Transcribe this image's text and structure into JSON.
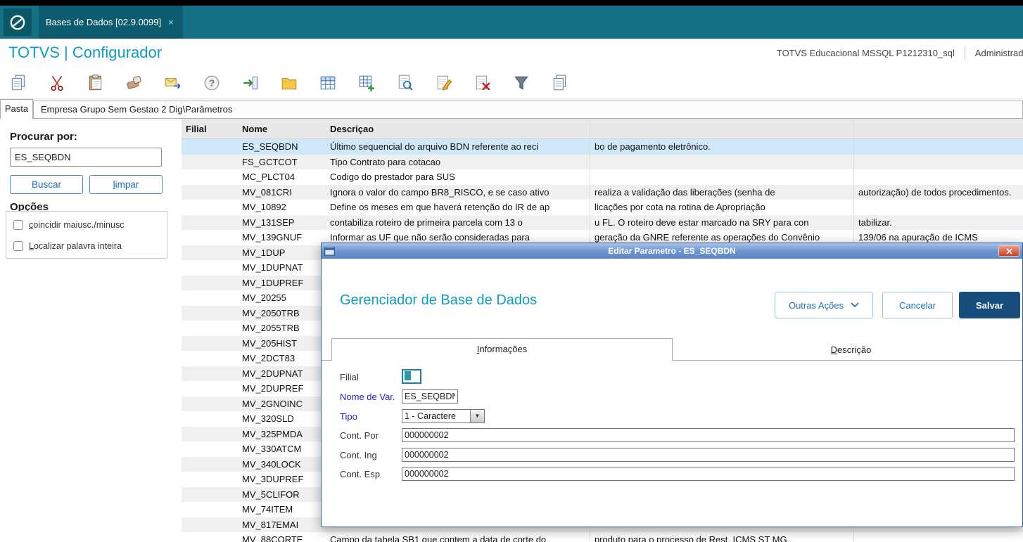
{
  "chrome": {
    "tab": {
      "title": "Bases de Dados [02.9.0099]",
      "close": "×"
    },
    "app_title": "TOTVS | Configurador",
    "environment": "TOTVS Educacional MSSQL P1212310_sql",
    "user": "Administrador"
  },
  "toolbar": {
    "icons": [
      "copy-icon",
      "cut-icon",
      "paste-icon",
      "eraser-icon",
      "send-mail-icon",
      "help-icon",
      "exit-icon",
      "folder-icon",
      "table-icon",
      "table-add-icon",
      "search-doc-icon",
      "edit-icon",
      "delete-doc-icon",
      "filter-icon",
      "copy-pages-icon"
    ]
  },
  "pasta": {
    "tab_label": "Pasta",
    "path": "Empresa Grupo Sem Gestao 2 Dig\\Parâmetros"
  },
  "search": {
    "label": "Procurar por:",
    "value": "ES_SEQBDN",
    "buscar_label": "Buscar",
    "limpar_label": "limpar",
    "options_title": "Opções",
    "options": [
      {
        "label": "coincidir maiusc./minusc",
        "checked": false
      },
      {
        "label": "Localizar palavra inteira",
        "checked": false
      }
    ]
  },
  "table": {
    "columns": [
      "Filial",
      "Nome",
      "Descriçao"
    ],
    "rows": [
      {
        "filial": "",
        "nome": "ES_SEQBDN",
        "desc1": "Último sequencial do arquivo BDN referente ao reci",
        "desc2": "bo de pagamento eletrônico.",
        "desc3": "",
        "selected": true
      },
      {
        "filial": "",
        "nome": "FS_GCTCOT",
        "desc1": "Tipo Contrato para cotacao",
        "desc2": "",
        "desc3": ""
      },
      {
        "filial": "",
        "nome": "MC_PLCT04",
        "desc1": "Codigo do prestador para SUS",
        "desc2": "",
        "desc3": ""
      },
      {
        "filial": "",
        "nome": "MV_081CRI",
        "desc1": "Ignora o valor do campo BR8_RISCO, e se caso ativo",
        "desc2": "realiza a validação das liberações (senha de",
        "desc3": "autorização) de todos procedimentos."
      },
      {
        "filial": "",
        "nome": "MV_10892",
        "desc1": "Define os meses em que haverá retenção do IR de ap",
        "desc2": "licações por cota na rotina de Apropriação",
        "desc3": ""
      },
      {
        "filial": "",
        "nome": "MV_131SEP",
        "desc1": "contabiliza roteiro de primeira parcela com 13 o",
        "desc2": "u FL. O roteiro deve estar marcado na SRY para con",
        "desc3": "tabilizar."
      },
      {
        "filial": "",
        "nome": "MV_139GNUF",
        "desc1": "Informar as UF que não serão consideradas para",
        "desc2": "geração da GNRE referente as operações do Convênio",
        "desc3": "139/06 na apuração de ICMS"
      },
      {
        "filial": "",
        "nome": "MV_1DUP",
        "desc1": "",
        "desc2": "",
        "desc3": ""
      },
      {
        "filial": "",
        "nome": "MV_1DUPNAT",
        "desc1": "",
        "desc2": "",
        "desc3": ""
      },
      {
        "filial": "",
        "nome": "MV_1DUPREF",
        "desc1": "",
        "desc2": "",
        "desc3": ""
      },
      {
        "filial": "",
        "nome": "MV_20255",
        "desc1": "",
        "desc2": "",
        "desc3": ""
      },
      {
        "filial": "",
        "nome": "MV_2050TRB",
        "desc1": "",
        "desc2": "",
        "desc3": ""
      },
      {
        "filial": "",
        "nome": "MV_2055TRB",
        "desc1": "",
        "desc2": "",
        "desc3": ""
      },
      {
        "filial": "",
        "nome": "MV_205HIST",
        "desc1": "",
        "desc2": "",
        "desc3": ""
      },
      {
        "filial": "",
        "nome": "MV_2DCT83",
        "desc1": "",
        "desc2": "",
        "desc3": ""
      },
      {
        "filial": "",
        "nome": "MV_2DUPNAT",
        "desc1": "",
        "desc2": "",
        "desc3": ""
      },
      {
        "filial": "",
        "nome": "MV_2DUPREF",
        "desc1": "",
        "desc2": "",
        "desc3": ""
      },
      {
        "filial": "",
        "nome": "MV_2GNOINC",
        "desc1": "",
        "desc2": "",
        "desc3": ""
      },
      {
        "filial": "",
        "nome": "MV_320SLD",
        "desc1": "",
        "desc2": "",
        "desc3": ""
      },
      {
        "filial": "",
        "nome": "MV_325PMDA",
        "desc1": "",
        "desc2": "",
        "desc3": ""
      },
      {
        "filial": "",
        "nome": "MV_330ATCM",
        "desc1": "",
        "desc2": "",
        "desc3": ""
      },
      {
        "filial": "",
        "nome": "MV_340LOCK",
        "desc1": "",
        "desc2": "",
        "desc3": ""
      },
      {
        "filial": "",
        "nome": "MV_3DUPREF",
        "desc1": "",
        "desc2": "",
        "desc3": ""
      },
      {
        "filial": "",
        "nome": "MV_5CLIFOR",
        "desc1": "",
        "desc2": "",
        "desc3": ""
      },
      {
        "filial": "",
        "nome": "MV_74ITEM",
        "desc1": "",
        "desc2": "",
        "desc3": ""
      },
      {
        "filial": "",
        "nome": "MV_817EMAI",
        "desc1": "",
        "desc2": "",
        "desc3": ""
      },
      {
        "filial": "",
        "nome": "MV_88CORTE",
        "desc1": "Campo da tabela SB1 que contem a data de corte do",
        "desc2": "produto para o processo de Rest. ICMS ST MG.",
        "desc3": ""
      }
    ]
  },
  "dialog": {
    "title": "Editar Parametro - ES_SEQBDN",
    "heading": "Gerenciador de Base de Dados",
    "outras_acoes_label": "Outras Ações",
    "cancelar_label": "Cancelar",
    "salvar_label": "Salvar",
    "tabs": [
      {
        "label": "Informações",
        "active": true
      },
      {
        "label": "Descrição",
        "active": false
      }
    ],
    "fields": {
      "filial_label": "Filial",
      "filial_value": "",
      "nome_label": "Nome de Var.",
      "nome_value": "ES_SEQBDN",
      "tipo_label": "Tipo",
      "tipo_value": "1 - Caractere",
      "cont_por_label": "Cont. Por",
      "cont_por_value": "000000002",
      "cont_ing_label": "Cont. Ing",
      "cont_ing_value": "000000002",
      "cont_esp_label": "Cont. Esp",
      "cont_esp_value": "000000002"
    }
  },
  "colors": {
    "teal_bar": "#147085",
    "accent_cyan": "#0d9ec6",
    "selected_row": "#cfe9fb",
    "salvar_bg": "#174e7d",
    "dialog_title_bg": "#5d87c4"
  }
}
